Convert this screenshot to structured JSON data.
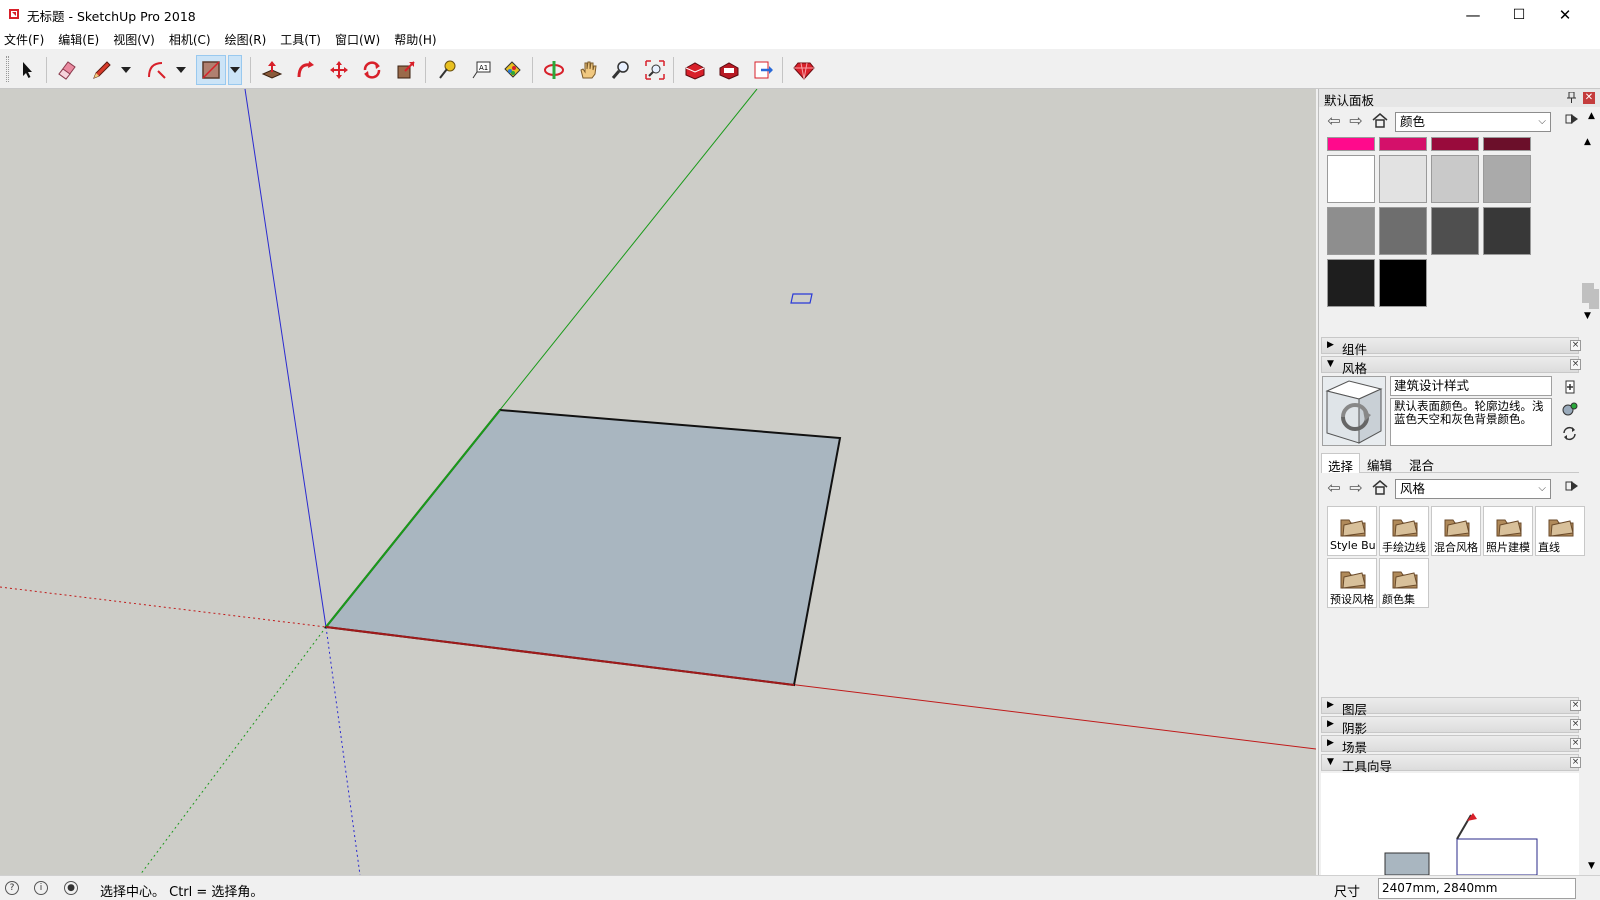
{
  "window": {
    "title": "无标题 - SketchUp Pro 2018",
    "minimize": "—",
    "maximize": "☐",
    "close": "✕"
  },
  "menu": [
    "文件(F)",
    "编辑(E)",
    "视图(V)",
    "相机(C)",
    "绘图(R)",
    "工具(T)",
    "窗口(W)",
    "帮助(H)"
  ],
  "toolbar": {
    "tools": [
      "select",
      "eraser",
      "pencil",
      "arc",
      "rectangle",
      "push-pull",
      "follow-me",
      "move",
      "rotate",
      "scale",
      "tape-measure",
      "text",
      "paint-bucket",
      "orbit",
      "pan",
      "zoom",
      "zoom-extents",
      "warehouse",
      "extension-warehouse",
      "send-to-layout",
      "extension-manager"
    ],
    "active_tool": "rectangle"
  },
  "tray": {
    "title": "默认面板",
    "materials": {
      "dropdown": "颜色",
      "swatch_colors": [
        "#ff0a8c",
        "#d4106a",
        "#990b3c",
        "#6b0f2a",
        "#ffffff",
        "#e2e2e2",
        "#c9c9c9",
        "#aaaaaa",
        "#8e8e8e",
        "#6e6e6e",
        "#4f4f4f",
        "#383838",
        "#1e1e1e",
        "#000000"
      ]
    },
    "sections": {
      "components": "组件",
      "styles": "风格",
      "layers": "图层",
      "shadows": "阴影",
      "scenes": "场景",
      "instructor": "工具向导"
    },
    "style": {
      "name": "建筑设计样式",
      "description": "默认表面颜色。轮廓边线。浅蓝色天空和灰色背景颜色。",
      "tabs": [
        "选择",
        "编辑",
        "混合"
      ],
      "dropdown": "风格",
      "folders": [
        "Style Builder Competition Winners",
        "手绘边线",
        "混合风格",
        "照片建模",
        "直线",
        "预设风格",
        "颜色集"
      ]
    }
  },
  "status": {
    "text": "选择中心。  Ctrl = 选择角。",
    "measure_label": "尺寸",
    "measure_value": "2407mm, 2840mm"
  }
}
